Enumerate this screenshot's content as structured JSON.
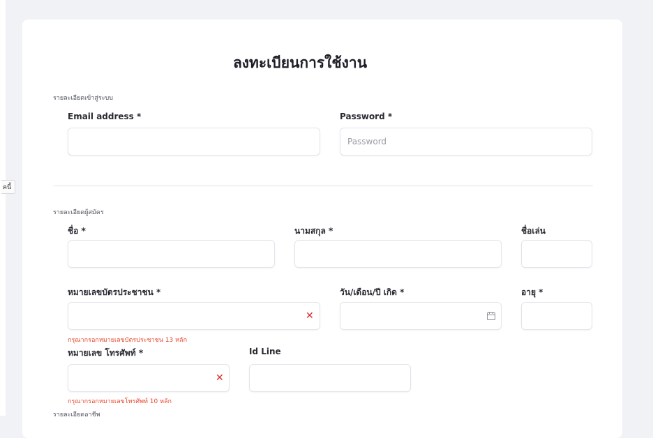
{
  "side_tab": {
    "text": "ฅนี้"
  },
  "form": {
    "title": "ลงทะเบียนการใช้งาน",
    "login_section": {
      "label": "รายละเอียดเข้าสู่ระบบ",
      "email": {
        "label": "Email address *",
        "value": "",
        "placeholder": ""
      },
      "password": {
        "label": "Password *",
        "value": "",
        "placeholder": "Password"
      }
    },
    "applicant_section": {
      "label": "รายละเอียดผู้สมัคร",
      "first_name": {
        "label": "ชื่อ *",
        "value": ""
      },
      "last_name": {
        "label": "นามสกุล *",
        "value": ""
      },
      "nickname": {
        "label": "ชื่อเล่น",
        "value": ""
      },
      "id_card": {
        "label": "หมายเลขบัตรประชาชน *",
        "value": "",
        "error": "กรุณากรอกหมายเลขบัตรประชาชน 13 หลัก",
        "clear_icon": "close-x-icon"
      },
      "birthdate": {
        "label": "วัน/เดือน/ปี เกิด *",
        "value": "",
        "icon": "calendar-icon"
      },
      "age": {
        "label": "อายุ *",
        "value": ""
      },
      "phone": {
        "label": "หมายเลข โทรศัพท์ *",
        "value": "",
        "error": "กรุณากรอกหมายเลขโทรศัพท์ 10 หลัก",
        "clear_icon": "close-x-icon"
      },
      "line_id": {
        "label": "Id Line",
        "value": ""
      }
    },
    "next_section": {
      "label": "รายละเอียดอาชีพ"
    }
  },
  "colors": {
    "error": "#e8472c",
    "clear_icon": "#e02424",
    "background": "#f1f2f5",
    "card": "#ffffff"
  }
}
